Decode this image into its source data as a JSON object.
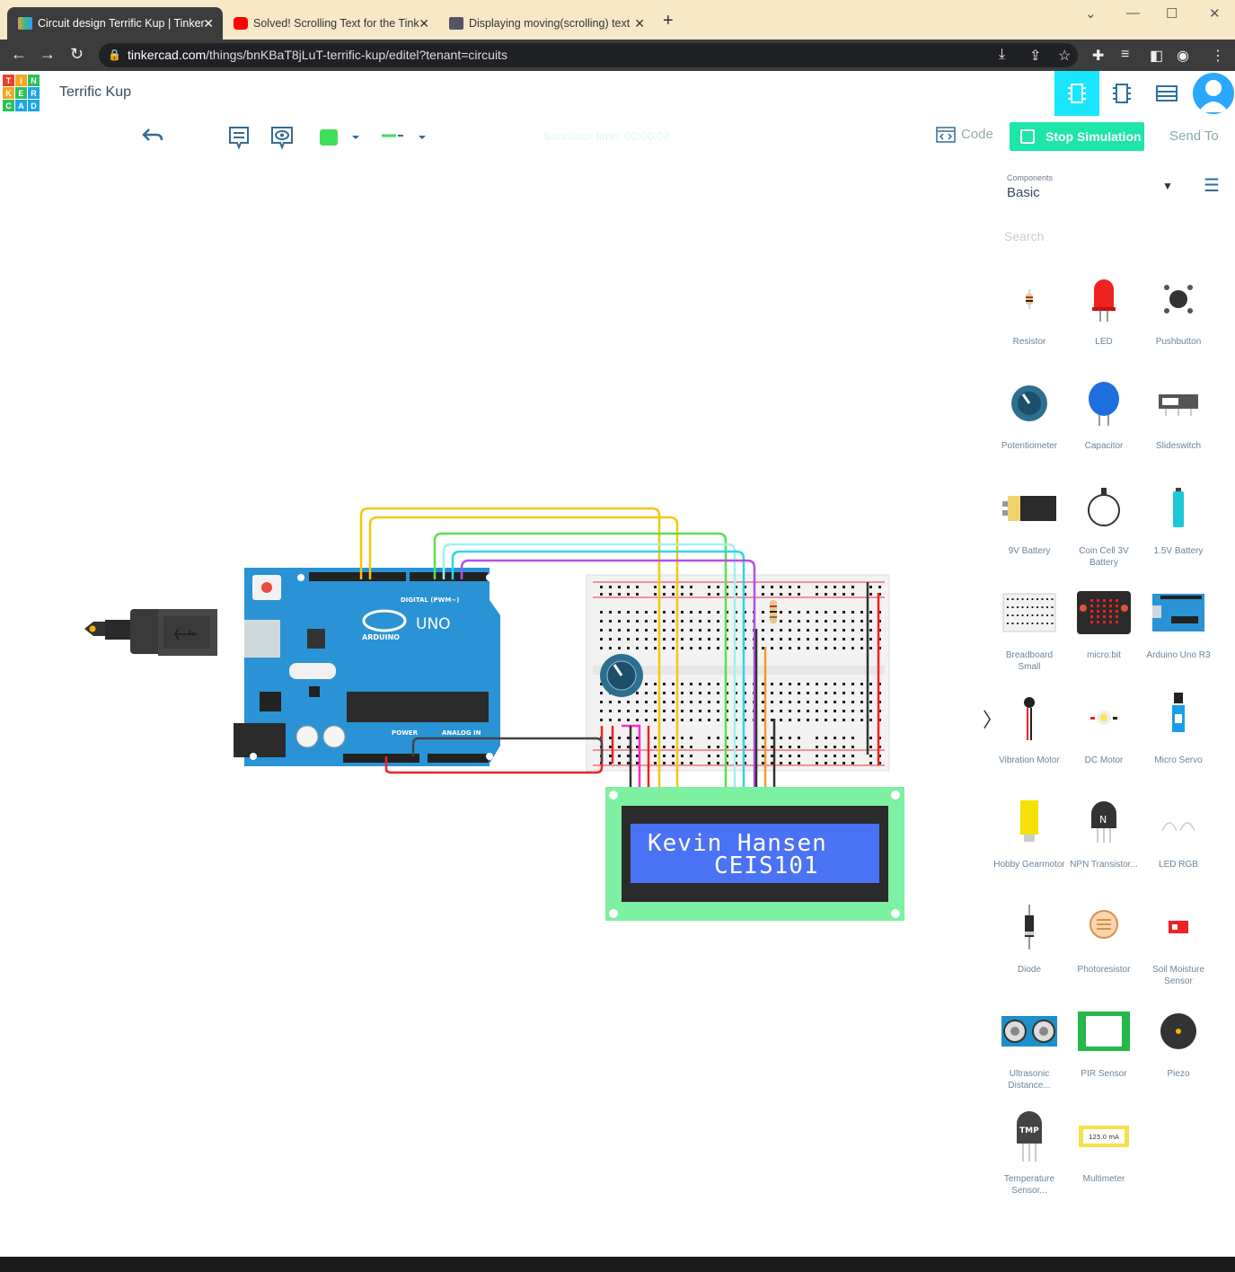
{
  "browser": {
    "tabs": [
      {
        "title": "Circuit design Terrific Kup | Tinker",
        "active": true
      },
      {
        "title": "Solved! Scrolling Text for the Tink"
      },
      {
        "title": "Displaying moving(scrolling) text"
      }
    ],
    "url_domain": "tinkercad.com",
    "url_path": "/things/bnKBaT8jLuT-terrific-kup/editel?tenant=circuits"
  },
  "app": {
    "logo_letters": [
      "T",
      "I",
      "N",
      "K",
      "E",
      "R",
      "C",
      "A",
      "D"
    ],
    "project_name": "Terrific Kup"
  },
  "toolbar": {
    "simulator_time": "Simulator time: 00:00:04",
    "code_label": "Code",
    "stop_label": "Stop Simulation",
    "send_to_label": "Send To"
  },
  "panel": {
    "components_label": "Components",
    "components_value": "Basic",
    "search_placeholder": "Search",
    "items": [
      {
        "label": "Resistor"
      },
      {
        "label": "LED"
      },
      {
        "label": "Pushbutton"
      },
      {
        "label": "Potentiometer"
      },
      {
        "label": "Capacitor"
      },
      {
        "label": "Slideswitch"
      },
      {
        "label": "9V Battery"
      },
      {
        "label": "Coin Cell 3V Battery"
      },
      {
        "label": "1.5V Battery"
      },
      {
        "label": "Breadboard Small"
      },
      {
        "label": "micro:bit"
      },
      {
        "label": "Arduino Uno R3"
      },
      {
        "label": "Vibration Motor"
      },
      {
        "label": "DC Motor"
      },
      {
        "label": "Micro Servo"
      },
      {
        "label": "Hobby Gearmotor"
      },
      {
        "label": "NPN Transistor..."
      },
      {
        "label": "LED RGB"
      },
      {
        "label": "Diode"
      },
      {
        "label": "Photoresistor"
      },
      {
        "label": "Soil Moisture Sensor"
      },
      {
        "label": "Ultrasonic Distance..."
      },
      {
        "label": "PIR Sensor"
      },
      {
        "label": "Piezo"
      },
      {
        "label": "Temperature Sensor..."
      },
      {
        "label": "Multimeter"
      }
    ]
  },
  "canvas": {
    "arduino_brand": "ARDUINO",
    "arduino_model": "UNO",
    "arduino_digital_label": "DIGITAL (PWM~)",
    "arduino_power_label": "POWER",
    "arduino_analog_label": "ANALOG IN",
    "lcd_line1": "Kevin Hansen",
    "lcd_line2": "CEIS101",
    "multimeter_readout": "125.0 mA"
  }
}
